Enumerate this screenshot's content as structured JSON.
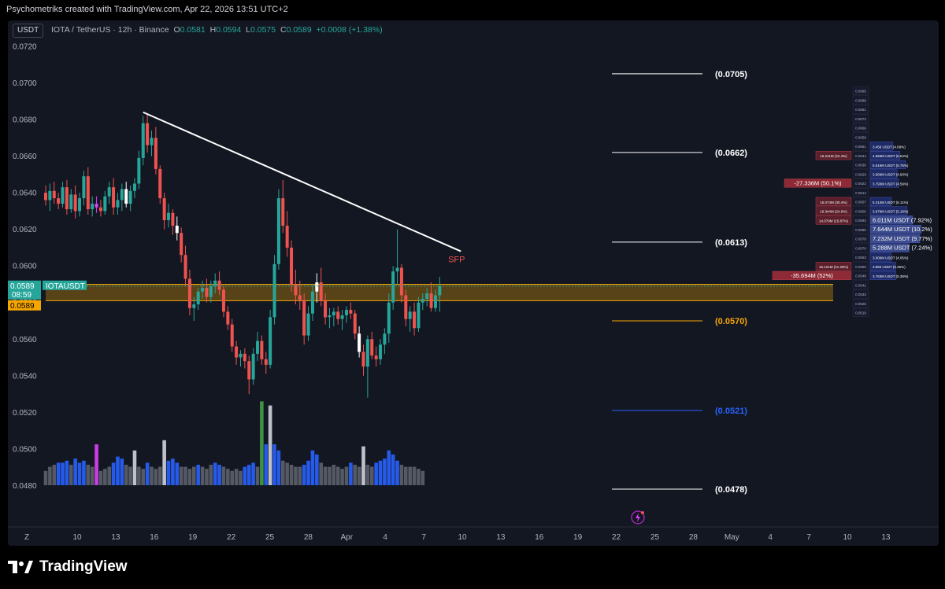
{
  "top_caption": "Psychometriks created with TradingView.com, Apr 22, 2026 13:51 UTC+2",
  "header": {
    "currency_button": "USDT",
    "symbol_line": "IOTA / TetherUS · 12h · Binance",
    "o_label": "O",
    "o_value": "0.0581",
    "h_label": "H",
    "h_value": "0.0594",
    "l_label": "L",
    "l_value": "0.0575",
    "c_label": "C",
    "c_value": "0.0589",
    "change": "+0.0008 (+1.38%)"
  },
  "footer": {
    "brand": "TradingView"
  },
  "colors": {
    "up": "#26a69a",
    "down": "#ef5350",
    "bg": "#131722",
    "zone": "#f7a600",
    "volume_blue": "#2962ff",
    "volume_gray": "#5d606b",
    "volume_magenta": "#e040fb",
    "volume_green": "#43a047",
    "volume_white": "#d1d4dc"
  },
  "chart_data": {
    "type": "candlestick",
    "symbol": "IOTAUSDT",
    "interval": "12h",
    "exchange": "Binance",
    "y_axis": {
      "ticks": [
        "0.0720",
        "0.0700",
        "0.0680",
        "0.0660",
        "0.0640",
        "0.0620",
        "0.0600",
        "0.0580",
        "0.0560",
        "0.0540",
        "0.0520",
        "0.0500",
        "0.0480"
      ],
      "range": [
        0.0472,
        0.0723
      ]
    },
    "x_axis": {
      "ticks": [
        "10",
        "13",
        "16",
        "19",
        "22",
        "25",
        "28",
        "Apr",
        "4",
        "7",
        "10",
        "13",
        "16",
        "19",
        "22",
        "25",
        "28",
        "May",
        "4",
        "7",
        "10",
        "13"
      ],
      "corner_label": "Z"
    },
    "last_price": {
      "value": "0.0589",
      "symbol": "IOTAUSDT",
      "countdown": "08:59",
      "second_value": "0.0589"
    },
    "candles": [
      [
        0.064,
        0.0644,
        0.0633,
        0.0636
      ],
      [
        0.0636,
        0.0645,
        0.063,
        0.0641
      ],
      [
        0.0641,
        0.0646,
        0.0634,
        0.0637
      ],
      [
        0.0637,
        0.064,
        0.0631,
        0.0634
      ],
      [
        0.0634,
        0.0646,
        0.0632,
        0.0643
      ],
      [
        0.0643,
        0.0647,
        0.0628,
        0.0631
      ],
      [
        0.0631,
        0.0642,
        0.0629,
        0.0639
      ],
      [
        0.0639,
        0.0644,
        0.0626,
        0.063
      ],
      [
        0.063,
        0.064,
        0.0627,
        0.0637
      ],
      [
        0.0637,
        0.0652,
        0.0633,
        0.0649
      ],
      [
        0.0649,
        0.0654,
        0.0628,
        0.0631
      ],
      [
        0.0631,
        0.0638,
        0.0627,
        0.0634
      ],
      [
        0.0634,
        0.0638,
        0.0629,
        0.0632
      ],
      [
        0.0632,
        0.0636,
        0.0627,
        0.063
      ],
      [
        0.063,
        0.0641,
        0.0628,
        0.0638
      ],
      [
        0.0638,
        0.0646,
        0.0634,
        0.0643
      ],
      [
        0.0643,
        0.0648,
        0.0628,
        0.0632
      ],
      [
        0.0632,
        0.064,
        0.0628,
        0.0636
      ],
      [
        0.0636,
        0.0645,
        0.063,
        0.0642
      ],
      [
        0.0642,
        0.0646,
        0.0632,
        0.0634
      ],
      [
        0.0634,
        0.0644,
        0.063,
        0.0641
      ],
      [
        0.0641,
        0.0648,
        0.0637,
        0.0645
      ],
      [
        0.0645,
        0.0663,
        0.0642,
        0.0659
      ],
      [
        0.0659,
        0.0682,
        0.0655,
        0.0678
      ],
      [
        0.0678,
        0.0683,
        0.0662,
        0.0666
      ],
      [
        0.0666,
        0.0674,
        0.066,
        0.067
      ],
      [
        0.067,
        0.0676,
        0.065,
        0.0653
      ],
      [
        0.0653,
        0.0655,
        0.0634,
        0.0637
      ],
      [
        0.0637,
        0.064,
        0.062,
        0.0625
      ],
      [
        0.0625,
        0.0634,
        0.0621,
        0.0629
      ],
      [
        0.0629,
        0.0631,
        0.0617,
        0.0622
      ],
      [
        0.0622,
        0.0627,
        0.0614,
        0.0618
      ],
      [
        0.0618,
        0.0621,
        0.0602,
        0.0606
      ],
      [
        0.0606,
        0.0611,
        0.0589,
        0.0593
      ],
      [
        0.0593,
        0.0598,
        0.0573,
        0.0577
      ],
      [
        0.0577,
        0.0583,
        0.057,
        0.0579
      ],
      [
        0.0579,
        0.0588,
        0.0576,
        0.0586
      ],
      [
        0.0586,
        0.0592,
        0.0582,
        0.0588
      ],
      [
        0.0588,
        0.0593,
        0.058,
        0.0583
      ],
      [
        0.0583,
        0.0592,
        0.058,
        0.0589
      ],
      [
        0.0589,
        0.0596,
        0.0585,
        0.0592
      ],
      [
        0.0592,
        0.0597,
        0.0584,
        0.0587
      ],
      [
        0.0587,
        0.0589,
        0.0572,
        0.0575
      ],
      [
        0.0575,
        0.0578,
        0.0565,
        0.0568
      ],
      [
        0.0568,
        0.0571,
        0.0553,
        0.0556
      ],
      [
        0.0556,
        0.0559,
        0.0546,
        0.055
      ],
      [
        0.055,
        0.0554,
        0.0545,
        0.0552
      ],
      [
        0.0552,
        0.0555,
        0.0544,
        0.0548
      ],
      [
        0.0548,
        0.0551,
        0.053,
        0.0538
      ],
      [
        0.0538,
        0.0555,
        0.0535,
        0.0552
      ],
      [
        0.0552,
        0.0564,
        0.0548,
        0.0559
      ],
      [
        0.0559,
        0.0562,
        0.0546,
        0.0549
      ],
      [
        0.0549,
        0.0553,
        0.0541,
        0.0546
      ],
      [
        0.0546,
        0.0576,
        0.0544,
        0.0572
      ],
      [
        0.0572,
        0.0606,
        0.0568,
        0.0601
      ],
      [
        0.0601,
        0.0642,
        0.0598,
        0.0637
      ],
      [
        0.0637,
        0.0647,
        0.0618,
        0.0622
      ],
      [
        0.0622,
        0.063,
        0.0605,
        0.061
      ],
      [
        0.061,
        0.0614,
        0.0586,
        0.059
      ],
      [
        0.059,
        0.0598,
        0.0579,
        0.0584
      ],
      [
        0.0584,
        0.0592,
        0.0576,
        0.0581
      ],
      [
        0.0581,
        0.0585,
        0.0557,
        0.0562
      ],
      [
        0.0562,
        0.0578,
        0.0559,
        0.0574
      ],
      [
        0.0574,
        0.059,
        0.057,
        0.0586
      ],
      [
        0.0586,
        0.0596,
        0.058,
        0.0591
      ],
      [
        0.0591,
        0.0599,
        0.0578,
        0.0581
      ],
      [
        0.0581,
        0.0585,
        0.0568,
        0.0572
      ],
      [
        0.0572,
        0.0577,
        0.0566,
        0.0573
      ],
      [
        0.0573,
        0.0577,
        0.0567,
        0.0575
      ],
      [
        0.0575,
        0.0578,
        0.0568,
        0.0571
      ],
      [
        0.0571,
        0.0576,
        0.0565,
        0.0573
      ],
      [
        0.0573,
        0.0578,
        0.0569,
        0.0576
      ],
      [
        0.0576,
        0.058,
        0.0571,
        0.0574
      ],
      [
        0.0574,
        0.0576,
        0.056,
        0.0563
      ],
      [
        0.0563,
        0.0567,
        0.055,
        0.0553
      ],
      [
        0.0553,
        0.0557,
        0.054,
        0.0545
      ],
      [
        0.0545,
        0.0562,
        0.0528,
        0.056
      ],
      [
        0.056,
        0.0564,
        0.0549,
        0.0551
      ],
      [
        0.0551,
        0.0556,
        0.0545,
        0.0549
      ],
      [
        0.0549,
        0.056,
        0.0546,
        0.0557
      ],
      [
        0.0557,
        0.0566,
        0.0552,
        0.0563
      ],
      [
        0.0563,
        0.0585,
        0.0558,
        0.058
      ],
      [
        0.058,
        0.06,
        0.0576,
        0.0597
      ],
      [
        0.0597,
        0.062,
        0.059,
        0.0599
      ],
      [
        0.0599,
        0.0601,
        0.058,
        0.0584
      ],
      [
        0.0584,
        0.0587,
        0.0567,
        0.0571
      ],
      [
        0.0571,
        0.0578,
        0.0564,
        0.0575
      ],
      [
        0.0575,
        0.058,
        0.0562,
        0.0566
      ],
      [
        0.0566,
        0.0583,
        0.0564,
        0.058
      ],
      [
        0.058,
        0.0585,
        0.0576,
        0.0582
      ],
      [
        0.0582,
        0.0588,
        0.0578,
        0.0585
      ],
      [
        0.0585,
        0.0591,
        0.0575,
        0.0577
      ],
      [
        0.0577,
        0.0587,
        0.0575,
        0.0584
      ],
      [
        0.0584,
        0.0594,
        0.0575,
        0.0589
      ]
    ],
    "highlighted_candles": {
      "white": [
        19,
        31,
        64,
        74
      ],
      "magenta": [
        12
      ]
    },
    "volume": [
      [
        0.35,
        "gray"
      ],
      [
        0.45,
        "gray"
      ],
      [
        0.5,
        "gray"
      ],
      [
        0.55,
        "blue"
      ],
      [
        0.55,
        "blue"
      ],
      [
        0.6,
        "blue"
      ],
      [
        0.5,
        "gray"
      ],
      [
        0.65,
        "blue"
      ],
      [
        0.55,
        "blue"
      ],
      [
        0.6,
        "blue"
      ],
      [
        0.5,
        "gray"
      ],
      [
        0.45,
        "gray"
      ],
      [
        1.0,
        "magenta"
      ],
      [
        0.35,
        "gray"
      ],
      [
        0.4,
        "gray"
      ],
      [
        0.45,
        "gray"
      ],
      [
        0.55,
        "blue"
      ],
      [
        0.7,
        "blue"
      ],
      [
        0.65,
        "blue"
      ],
      [
        0.5,
        "gray"
      ],
      [
        0.45,
        "gray"
      ],
      [
        0.85,
        "white"
      ],
      [
        0.45,
        "gray"
      ],
      [
        0.4,
        "gray"
      ],
      [
        0.55,
        "blue"
      ],
      [
        0.45,
        "gray"
      ],
      [
        0.4,
        "gray"
      ],
      [
        0.45,
        "gray"
      ],
      [
        1.1,
        "white"
      ],
      [
        0.6,
        "blue"
      ],
      [
        0.65,
        "blue"
      ],
      [
        0.55,
        "blue"
      ],
      [
        0.45,
        "gray"
      ],
      [
        0.45,
        "gray"
      ],
      [
        0.4,
        "gray"
      ],
      [
        0.45,
        "gray"
      ],
      [
        0.5,
        "blue"
      ],
      [
        0.45,
        "gray"
      ],
      [
        0.4,
        "gray"
      ],
      [
        0.5,
        "gray"
      ],
      [
        0.55,
        "blue"
      ],
      [
        0.5,
        "blue"
      ],
      [
        0.45,
        "gray"
      ],
      [
        0.4,
        "gray"
      ],
      [
        0.35,
        "gray"
      ],
      [
        0.4,
        "gray"
      ],
      [
        0.35,
        "gray"
      ],
      [
        0.45,
        "blue"
      ],
      [
        0.5,
        "blue"
      ],
      [
        0.55,
        "blue"
      ],
      [
        0.45,
        "gray"
      ],
      [
        2.05,
        "green"
      ],
      [
        1.0,
        "blue"
      ],
      [
        1.95,
        "white"
      ],
      [
        1.0,
        "blue"
      ],
      [
        0.85,
        "blue"
      ],
      [
        0.6,
        "gray"
      ],
      [
        0.55,
        "gray"
      ],
      [
        0.5,
        "gray"
      ],
      [
        0.45,
        "gray"
      ],
      [
        0.45,
        "gray"
      ],
      [
        0.5,
        "blue"
      ],
      [
        0.6,
        "blue"
      ],
      [
        0.85,
        "blue"
      ],
      [
        0.75,
        "blue"
      ],
      [
        0.55,
        "gray"
      ],
      [
        0.45,
        "gray"
      ],
      [
        0.45,
        "gray"
      ],
      [
        0.5,
        "gray"
      ],
      [
        0.45,
        "gray"
      ],
      [
        0.4,
        "gray"
      ],
      [
        0.45,
        "gray"
      ],
      [
        0.55,
        "blue"
      ],
      [
        0.5,
        "gray"
      ],
      [
        0.45,
        "gray"
      ],
      [
        0.95,
        "white"
      ],
      [
        0.5,
        "gray"
      ],
      [
        0.45,
        "gray"
      ],
      [
        0.55,
        "blue"
      ],
      [
        0.6,
        "blue"
      ],
      [
        0.65,
        "blue"
      ],
      [
        0.85,
        "blue"
      ],
      [
        0.75,
        "blue"
      ],
      [
        0.6,
        "blue"
      ],
      [
        0.5,
        "gray"
      ],
      [
        0.45,
        "gray"
      ],
      [
        0.45,
        "gray"
      ],
      [
        0.45,
        "gray"
      ],
      [
        0.4,
        "gray"
      ],
      [
        0.35,
        "gray"
      ]
    ],
    "levels": [
      {
        "value": 0.0705,
        "label": "(0.0705)",
        "color": "#ffffff"
      },
      {
        "value": 0.0662,
        "label": "(0.0662)",
        "color": "#ffffff"
      },
      {
        "value": 0.0613,
        "label": "(0.0613)",
        "color": "#ffffff"
      },
      {
        "value": 0.057,
        "label": "(0.0570)",
        "color": "#f7a600"
      },
      {
        "value": 0.0521,
        "label": "(0.0521)",
        "color": "#2962ff"
      },
      {
        "value": 0.0478,
        "label": "(0.0478)",
        "color": "#ffffff"
      }
    ],
    "zone": {
      "low": 0.0581,
      "high": 0.059
    },
    "trendline": {
      "from": [
        23,
        0.0684
      ],
      "to": [
        98,
        0.0608
      ]
    },
    "annotation": {
      "text": "SFP",
      "at": [
        95,
        0.0602
      ],
      "color": "#ef5350"
    },
    "orderbook": {
      "price_ladder": [
        "0.0695",
        "0.0688",
        "0.0681",
        "0.0673",
        "0.0666",
        "0.0659",
        "0.0651",
        "0.0644",
        "0.0636",
        "0.0629",
        "0.0622",
        "0.0614",
        "0.0607",
        "0.0600",
        "0.0592",
        "0.0585",
        "0.0578",
        "0.0570",
        "0.0563",
        "0.0555",
        "0.0548",
        "0.0541",
        "0.0533",
        "0.0526",
        "0.0519"
      ],
      "asks": [
        {
          "price": "0.0651",
          "text": "3.456 USDT (4.09%)",
          "width": 0.32
        },
        {
          "price": "0.0644",
          "text": "4.656M USDT (5.64%)",
          "width": 0.42
        },
        {
          "price": "0.0636",
          "text": "5.516M USDT (6.76%)",
          "width": 0.5
        },
        {
          "price": "0.0629",
          "text": "3.969M USDT (4.93%)",
          "width": 0.38
        },
        {
          "price": "0.0622",
          "text": "3.793M USDT (4.59%)",
          "width": 0.4
        },
        {
          "price": "0.0607",
          "text": "5.314M USDT (6.11%)",
          "width": 0.3
        },
        {
          "price": "0.0600",
          "text": "3.979M USDT (5.18%)",
          "width": 0.52
        },
        {
          "price": "0.0592",
          "text": "6.011M USDT (7.92%)",
          "width": 0.6
        },
        {
          "price": "0.0585",
          "text": "7.644M USDT (10.2%)",
          "width": 0.72
        },
        {
          "price": "0.0578",
          "text": "7.232M USDT (9.77%)",
          "width": 0.7
        },
        {
          "price": "0.0570",
          "text": "5.288M USDT (7.24%)",
          "width": 0.55
        },
        {
          "price": "0.0563",
          "text": "3.006M USDT (4.05%)",
          "width": 0.3
        },
        {
          "price": "0.0555",
          "text": "3.856 USDT (5.45%)",
          "width": 0.36
        },
        {
          "price": "0.0548",
          "text": "3.763M USDT (5.38%)",
          "width": 0.36
        }
      ],
      "bids": [
        {
          "price": "0.0644",
          "text": "16.211M (22.4%)",
          "width": 0.45
        },
        {
          "price": "0.0622",
          "text": "-27.336M (50.1%)",
          "width": 0.85
        },
        {
          "price": "0.0607",
          "text": "15.074M (30.4%)",
          "width": 0.45
        },
        {
          "price": "0.0600",
          "text": "16.344M (24.6%)",
          "width": 0.45
        },
        {
          "price": "0.0592",
          "text": "14.079M (15.87%)",
          "width": 0.45
        },
        {
          "price": "0.0555",
          "text": "16.121M (21.26%)",
          "width": 0.45
        },
        {
          "price": "0.0548",
          "text": "-35.694M (52%)",
          "width": 1.0
        }
      ]
    }
  }
}
